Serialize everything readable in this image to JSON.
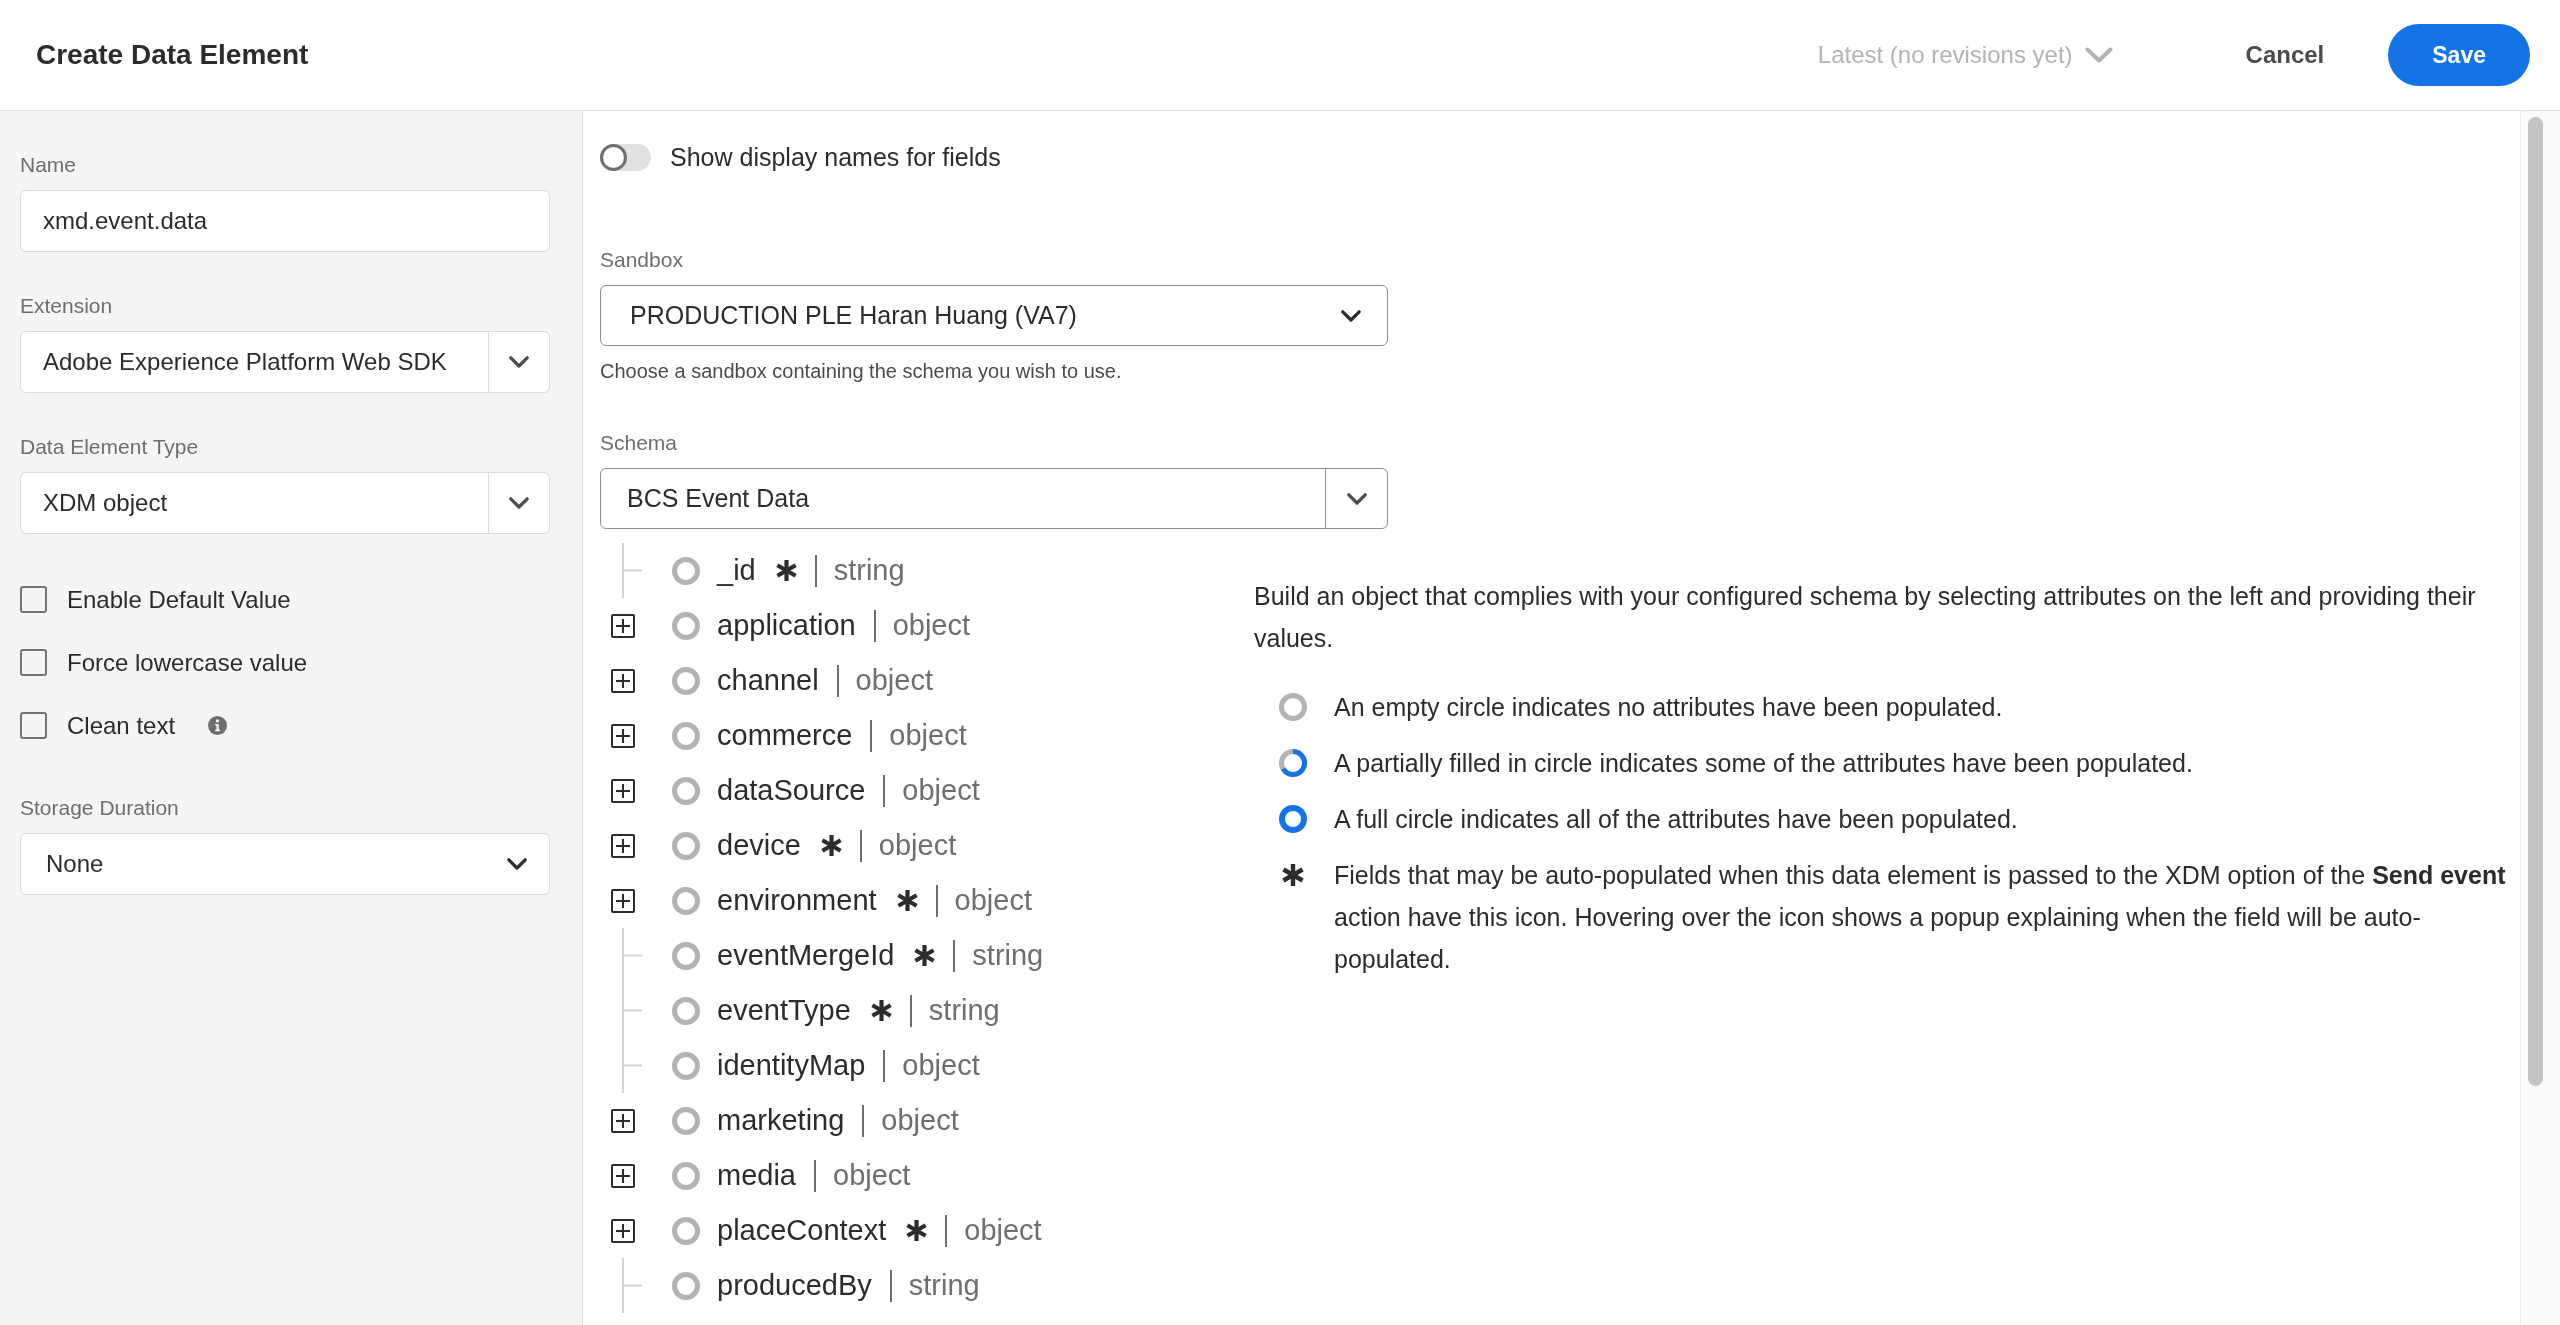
{
  "header": {
    "title": "Create Data Element",
    "revision": {
      "label": "Latest (no revisions yet)",
      "disabled": true
    },
    "buttons": [
      {
        "label": "Cancel",
        "kind": "quiet"
      },
      {
        "label": "Save",
        "kind": "primary"
      }
    ]
  },
  "sidebar": {
    "fields": [
      {
        "kind": "text",
        "label": "Name",
        "value": "xmd.event.data"
      },
      {
        "kind": "combo",
        "label": "Extension",
        "value": "Adobe Experience Platform Web SDK"
      },
      {
        "kind": "combo",
        "label": "Data Element Type",
        "value": "XDM object"
      }
    ],
    "options": [
      {
        "label": "Enable Default Value",
        "checked": false,
        "info": false
      },
      {
        "label": "Force lowercase value",
        "checked": false,
        "info": false
      },
      {
        "label": "Clean text",
        "checked": false,
        "info": true
      }
    ],
    "storage": {
      "kind": "select",
      "label": "Storage Duration",
      "value": "None"
    }
  },
  "main": {
    "display_names": {
      "label": "Show display names for fields",
      "on": false
    },
    "sandbox": {
      "kind": "select",
      "label": "Sandbox",
      "value": "PRODUCTION PLE Haran Huang (VA7)",
      "help": "Choose a sandbox containing the schema you wish to use."
    },
    "schema": {
      "kind": "combo",
      "label": "Schema",
      "value": "BCS Event Data"
    },
    "tree": [
      {
        "name": "_id",
        "type": "string",
        "kind": "leaf",
        "auto_populated": true,
        "populated": false
      },
      {
        "name": "application",
        "type": "object",
        "kind": "branch",
        "auto_populated": false,
        "populated": false
      },
      {
        "name": "channel",
        "type": "object",
        "kind": "branch",
        "auto_populated": false,
        "populated": false
      },
      {
        "name": "commerce",
        "type": "object",
        "kind": "branch",
        "auto_populated": false,
        "populated": false
      },
      {
        "name": "dataSource",
        "type": "object",
        "kind": "branch",
        "auto_populated": false,
        "populated": false
      },
      {
        "name": "device",
        "type": "object",
        "kind": "branch",
        "auto_populated": true,
        "populated": false
      },
      {
        "name": "environment",
        "type": "object",
        "kind": "branch",
        "auto_populated": true,
        "populated": false
      },
      {
        "name": "eventMergeId",
        "type": "string",
        "kind": "leaf",
        "auto_populated": true,
        "populated": false
      },
      {
        "name": "eventType",
        "type": "string",
        "kind": "leaf",
        "auto_populated": true,
        "populated": false
      },
      {
        "name": "identityMap",
        "type": "object",
        "kind": "leaf",
        "auto_populated": false,
        "populated": false
      },
      {
        "name": "marketing",
        "type": "object",
        "kind": "branch",
        "auto_populated": false,
        "populated": false
      },
      {
        "name": "media",
        "type": "object",
        "kind": "branch",
        "auto_populated": false,
        "populated": false
      },
      {
        "name": "placeContext",
        "type": "object",
        "kind": "branch",
        "auto_populated": true,
        "populated": false
      },
      {
        "name": "producedBy",
        "type": "string",
        "kind": "leaf",
        "auto_populated": false,
        "populated": false
      }
    ],
    "description": {
      "intro": "Build an object that complies with your configured schema by selecting attributes on the left and providing their values.",
      "legend": [
        {
          "kind": "empty",
          "text": "An empty circle indicates no attributes have been populated."
        },
        {
          "kind": "partial",
          "text": "A partially filled in circle indicates some of the attributes have been populated."
        },
        {
          "kind": "full",
          "text": "A full circle indicates all of the attributes have been populated."
        },
        {
          "kind": "auto",
          "text": "Fields that may be auto-populated when this data element is passed to the XDM option of the **Send event** action have this icon. Hovering over the icon shows a popup explaining when the field will be auto-populated."
        }
      ]
    }
  }
}
